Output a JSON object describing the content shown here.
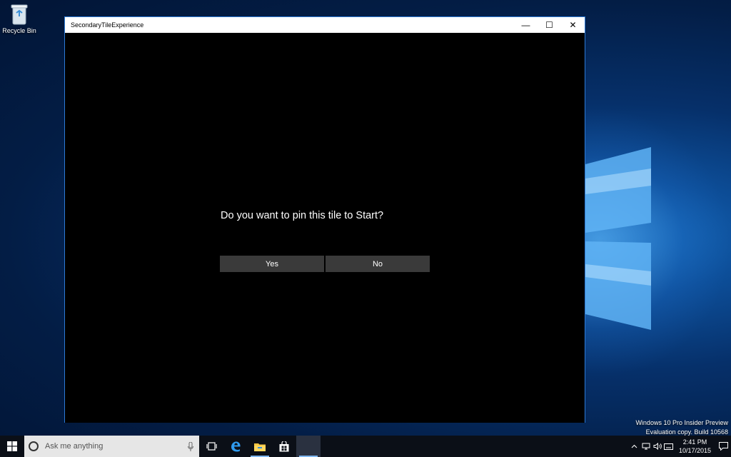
{
  "desktop": {
    "icons": [
      {
        "label": "Recycle Bin",
        "icon": "recycle-bin-icon"
      }
    ],
    "watermark": {
      "line1": "Windows 10 Pro Insider Preview",
      "line2": "Evaluation copy. Build 10568"
    }
  },
  "window": {
    "title": "SecondaryTileExperience",
    "controls": {
      "minimize": "—",
      "maximize": "☐",
      "close": "✕"
    },
    "question": "Do you want to pin this tile to Start?",
    "buttons": {
      "yes": "Yes",
      "no": "No"
    },
    "accent": "#2c7ad6"
  },
  "taskbar": {
    "search_placeholder": "Ask me anything",
    "pinned": [
      {
        "name": "task-view-icon"
      },
      {
        "name": "edge-icon"
      },
      {
        "name": "file-explorer-icon"
      },
      {
        "name": "store-icon"
      },
      {
        "name": "running-app"
      }
    ],
    "tray": {
      "time": "2:41 PM",
      "date": "10/17/2015"
    }
  }
}
